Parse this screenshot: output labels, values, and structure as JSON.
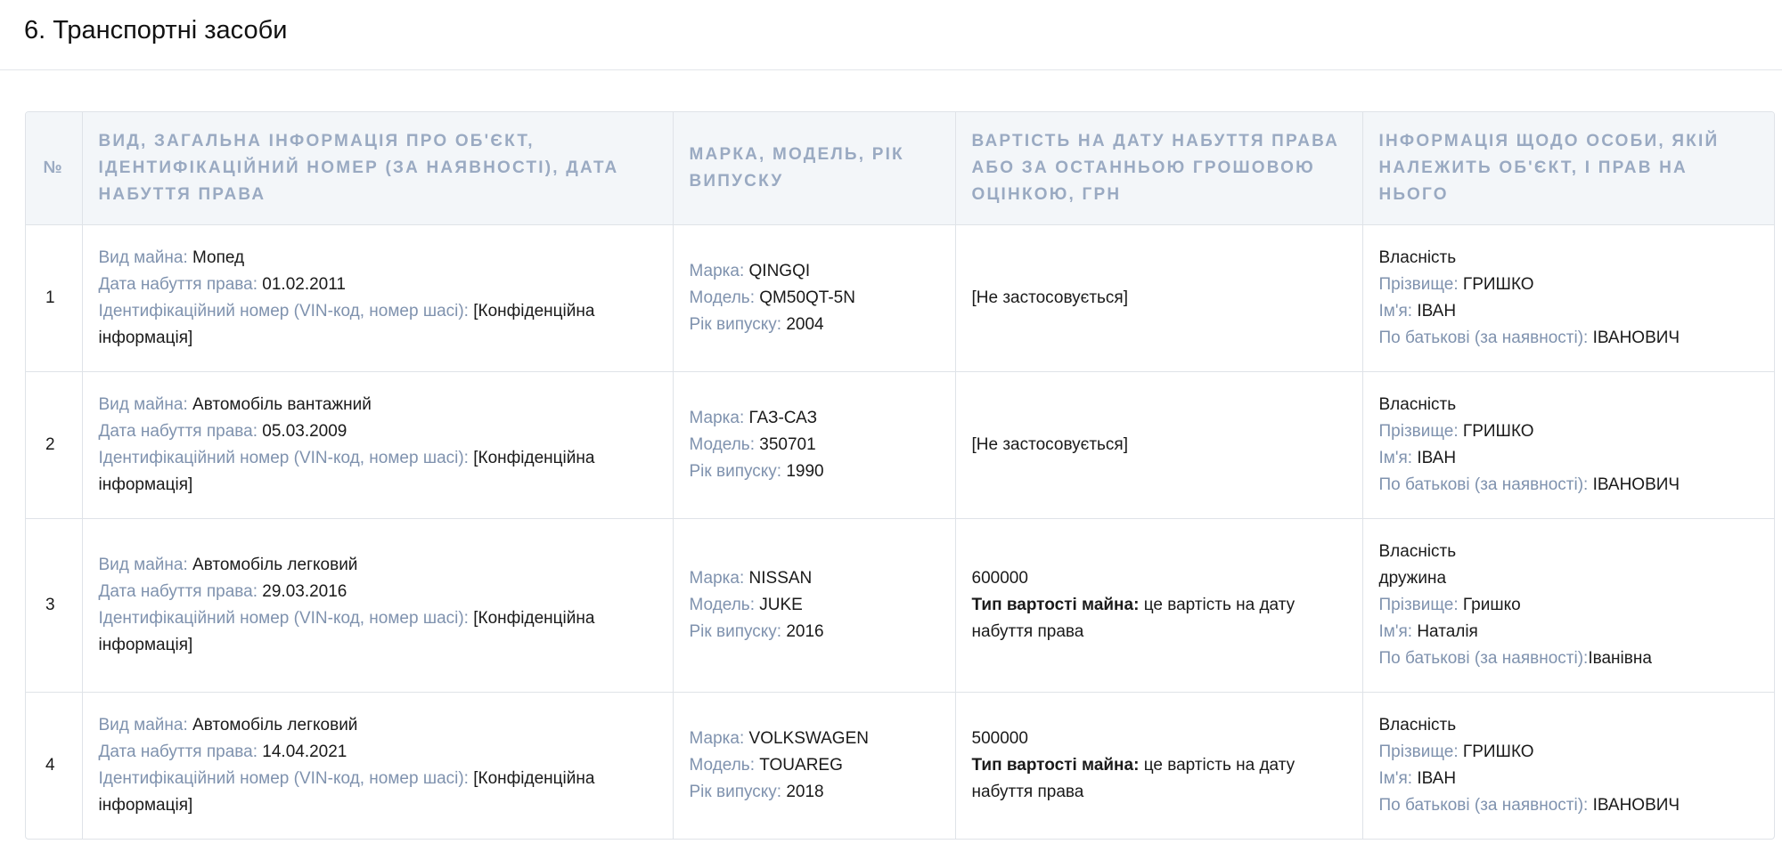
{
  "section": {
    "title": "6. Транспортні засоби"
  },
  "table": {
    "headers": {
      "num": "№",
      "type": "Вид, загальна інформація про об'єкт, ідентифікаційний номер (за наявності), дата набуття права",
      "brand": "Марка, модель, рік випуску",
      "value": "Вартість на дату набуття права або за останньою грошовою оцінкою, грн",
      "owner": "Інформація щодо особи, якій належить об'єкт, і прав на нього"
    },
    "labels": {
      "property_type": "Вид майна:",
      "acquired_date": "Дата набуття права:",
      "vin": "Ідентифікаційний номер (VIN-код, номер шасі):",
      "make": "Марка:",
      "model": "Модель:",
      "year": "Рік випуску:",
      "value_type": "Тип вартості майна:",
      "surname": "Прізвище:",
      "name": "Ім'я:",
      "patronymic": "По батькові (за наявності):"
    },
    "rows": [
      {
        "num": "1",
        "property_type": "Мопед",
        "acquired_date": "01.02.2011",
        "vin": "[Конфіденційна інформація]",
        "make": "QINGQI",
        "model": "QM50QT-5N",
        "year": "2004",
        "value": "[Не застосовується]",
        "value_type": "",
        "ownership": "Власність",
        "relation": "",
        "surname": "ГРИШКО",
        "name": "ІВАН",
        "patronymic": "ІВАНОВИЧ"
      },
      {
        "num": "2",
        "property_type": "Автомобіль вантажний",
        "acquired_date": "05.03.2009",
        "vin": "[Конфіденційна інформація]",
        "make": "ГАЗ-САЗ",
        "model": "350701",
        "year": "1990",
        "value": "[Не застосовується]",
        "value_type": "",
        "ownership": "Власність",
        "relation": "",
        "surname": "ГРИШКО",
        "name": "ІВАН",
        "patronymic": "ІВАНОВИЧ"
      },
      {
        "num": "3",
        "property_type": "Автомобіль легковий",
        "acquired_date": "29.03.2016",
        "vin": "[Конфіденційна інформація]",
        "make": "NISSAN",
        "model": "JUKE",
        "year": "2016",
        "value": "600000",
        "value_type": "це вартість на дату набуття права",
        "ownership": "Власність",
        "relation": "дружина",
        "surname": "Гришко",
        "name": "Наталія",
        "patronymic": "Іванівна"
      },
      {
        "num": "4",
        "property_type": "Автомобіль легковий",
        "acquired_date": "14.04.2021",
        "vin": "[Конфіденційна інформація]",
        "make": "VOLKSWAGEN",
        "model": "TOUAREG",
        "year": "2018",
        "value": "500000",
        "value_type": "це вартість на дату набуття права",
        "ownership": "Власність",
        "relation": "",
        "surname": "ГРИШКО",
        "name": "ІВАН",
        "patronymic": "ІВАНОВИЧ"
      }
    ]
  }
}
